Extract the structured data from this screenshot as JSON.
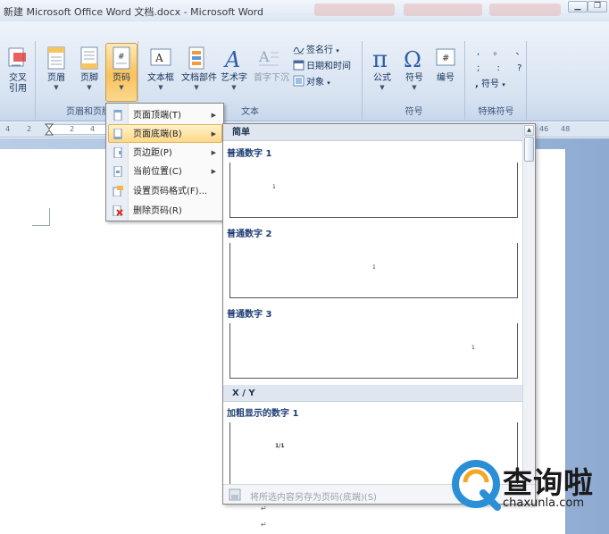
{
  "window": {
    "title": "新建 Microsoft Office Word 文档.docx - Microsoft Word"
  },
  "ribbon": {
    "groups": {
      "xref": {
        "label": "交叉\n引用",
        "line1": "交叉",
        "line2": "引用"
      },
      "header_footer": {
        "label": "页眉和页脚",
        "header_label": "页眉",
        "footer_label": "页脚",
        "page_number_label": "页码"
      },
      "text": {
        "label": "文本",
        "textbox_label": "文本框",
        "quickparts_label": "文档部件",
        "wordart_label": "艺术字",
        "dropcap_label": "首字下沉",
        "signature_label": "签名行",
        "datetime_label": "日期和时间",
        "object_label": "对象"
      },
      "symbols": {
        "label": "符号",
        "equation_label": "公式",
        "symbol_label": "符号",
        "number_label": "编号"
      },
      "special": {
        "label": "特殊符号",
        "symbol_label": "符号",
        "glyph_row1": ", 。 、",
        "glyph_row2": "; : ?"
      }
    }
  },
  "ruler": {
    "numbers": [
      "4",
      "2",
      "2",
      "4",
      "46",
      "48"
    ]
  },
  "page_number_menu": {
    "items": [
      {
        "label": "页面顶端(T)",
        "icon": "page-top-icon",
        "submenu": true
      },
      {
        "label": "页面底端(B)",
        "icon": "page-bottom-icon",
        "submenu": true,
        "highlighted": true
      },
      {
        "label": "页边距(P)",
        "icon": "page-margin-icon",
        "submenu": true
      },
      {
        "label": "当前位置(C)",
        "icon": "current-position-icon",
        "submenu": true
      },
      {
        "label": "设置页码格式(F)...",
        "icon": "format-page-number-icon",
        "submenu": false
      },
      {
        "label": "删除页码(R)",
        "icon": "remove-page-number-icon",
        "submenu": false
      }
    ]
  },
  "gallery": {
    "section_simple": "简单",
    "section_xy": "X / Y",
    "items": [
      {
        "title": "普通数字 1",
        "page_number": "1",
        "align": "left"
      },
      {
        "title": "普通数字 2",
        "page_number": "1",
        "align": "center"
      },
      {
        "title": "普通数字 3",
        "page_number": "1",
        "align": "right"
      },
      {
        "title": "加粗显示的数字 1",
        "page_number": "1/1",
        "align": "left"
      }
    ],
    "footer_label": "将所选内容另存为页码(底端)(S)"
  },
  "document": {
    "paragraph_mark": "↵"
  },
  "watermark": {
    "brand_text": "查询啦",
    "url": "chaxunla.com",
    "colors": {
      "ring": "#2a8fd6",
      "accent": "#f5a623"
    }
  }
}
